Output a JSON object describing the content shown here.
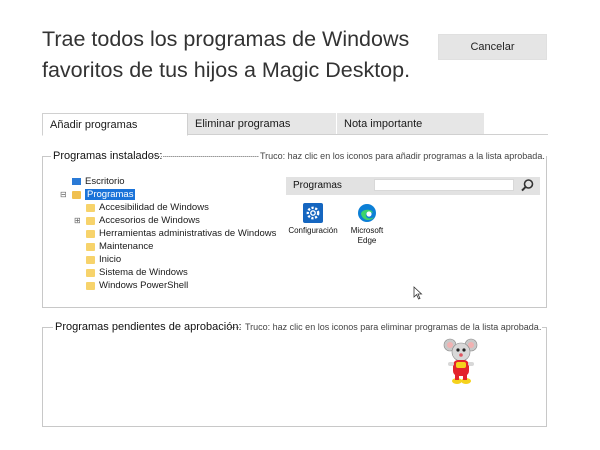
{
  "header": {
    "title_line1": "Trae todos los programas de Windows",
    "title_line2": "favoritos de tus hijos a Magic Desktop.",
    "cancel_label": "Cancelar"
  },
  "tabs": [
    {
      "label": "Añadir programas",
      "active": true
    },
    {
      "label": "Eliminar programas",
      "active": false
    },
    {
      "label": "Nota importante",
      "active": false
    }
  ],
  "installed": {
    "legend": "Programas instalados:",
    "tip": "Truco: haz clic en los iconos para añadir programas a la lista aprobada.",
    "tree": {
      "desktop": "Escritorio",
      "programs": "Programas",
      "children": [
        "Accesibilidad de Windows",
        "Accesorios de Windows",
        "Herramientas administrativas de Windows",
        "Maintenance",
        "Inicio",
        "Sistema de Windows",
        "Windows PowerShell"
      ]
    },
    "panel": {
      "title": "Programas",
      "search_value": "",
      "apps": [
        {
          "label": "Configuración",
          "icon": "gear-icon"
        },
        {
          "label_line1": "Microsoft",
          "label_line2": "Edge",
          "icon": "edge-icon"
        }
      ]
    }
  },
  "pending": {
    "legend": "Programas pendientes de aprobación:",
    "tip": "Truco: haz clic en los iconos para eliminar programas de la lista aprobada."
  },
  "colors": {
    "accent": "#1a73d9",
    "folder": "#f7d36b",
    "tab_inactive": "#e6e6e6",
    "panel_header": "#e2e2e2"
  }
}
